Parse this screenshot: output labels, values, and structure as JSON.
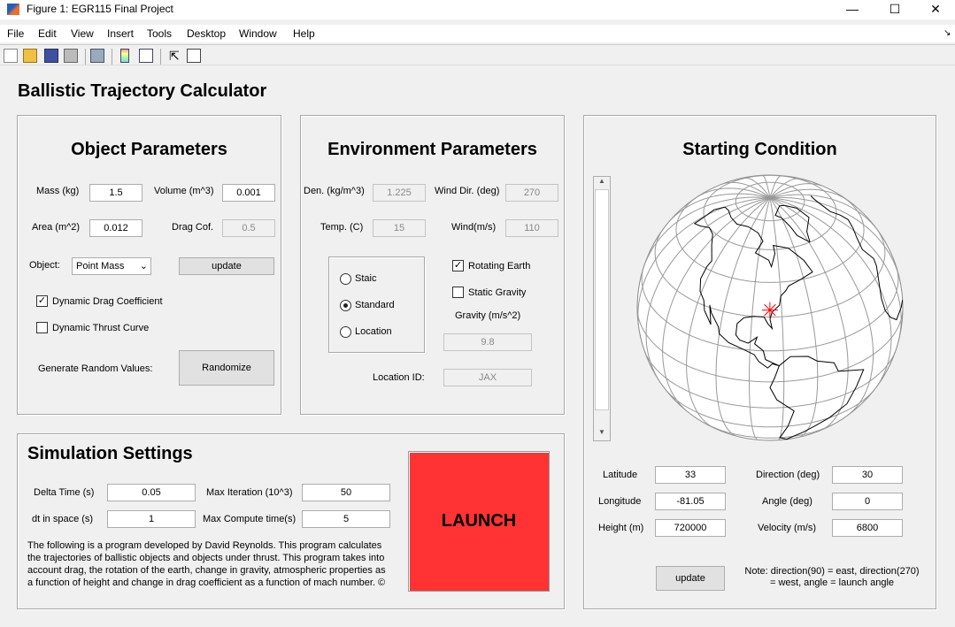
{
  "window": {
    "title": "Figure 1: EGR115 Final Project",
    "minimize": "—",
    "maximize": "☐",
    "close": "✕"
  },
  "menu": [
    "File",
    "Edit",
    "View",
    "Insert",
    "Tools",
    "Desktop",
    "Window",
    "Help"
  ],
  "toolbar": [
    "new-figure",
    "open-file",
    "save",
    "print",
    "link-plot",
    "insert-colorbar",
    "insert-legend",
    "edit-plot",
    "property-inspector"
  ],
  "app_title": "Ballistic Trajectory Calculator",
  "object": {
    "title": "Object Parameters",
    "mass_label": "Mass (kg)",
    "mass": "1.5",
    "volume_label": "Volume (m^3)",
    "volume": "0.001",
    "area_label": "Area (m^2)",
    "area": "0.012",
    "drag_label": "Drag Cof.",
    "drag": "0.5",
    "object_label": "Object:",
    "object_value": "Point Mass",
    "update": "update",
    "dynamic_drag": "Dynamic Drag Coefficient",
    "dynamic_drag_checked": true,
    "dynamic_thrust": "Dynamic Thrust Curve",
    "dynamic_thrust_checked": false,
    "random_label": "Generate Random Values:",
    "randomize": "Randomize"
  },
  "environment": {
    "title": "Environment Parameters",
    "den_label": "Den. (kg/m^3)",
    "den": "1.225",
    "winddir_label": "Wind Dir. (deg)",
    "winddir": "270",
    "temp_label": "Temp. (C)",
    "temp": "15",
    "wind_label": "Wind(m/s)",
    "wind": "110",
    "radios": [
      "Staic",
      "Standard",
      "Location"
    ],
    "radio_selected": 1,
    "rotating": "Rotating Earth",
    "rotating_checked": true,
    "static_gravity": "Static Gravity",
    "static_gravity_checked": false,
    "gravity_label": "Gravity (m/s^2)",
    "gravity": "9.8",
    "location_label": "Location ID:",
    "location": "JAX"
  },
  "start": {
    "title": "Starting Condition",
    "lat_label": "Latitude",
    "lat": "33",
    "lon_label": "Longitude",
    "lon": "-81.05",
    "height_label": "Height (m)",
    "height": "720000",
    "dir_label": "Direction (deg)",
    "dir": "30",
    "angle_label": "Angle (deg)",
    "angle": "0",
    "vel_label": "Velocity (m/s)",
    "vel": "6800",
    "update": "update",
    "note": "Note: direction(90) = east, direction(270) = west, angle = launch angle",
    "marker_color": "#ff0000"
  },
  "sim": {
    "title": "Simulation Settings",
    "dt_label": "Delta Time (s)",
    "dt": "0.05",
    "maxit_label": "Max Iteration (10^3)",
    "maxit": "50",
    "dts_label": "dt in space (s)",
    "dts": "1",
    "maxct_label": "Max Compute time(s)",
    "maxct": "5",
    "description": "The following is a program developed by David Reynolds. This program calculates the trajectories of ballistic objects and objects under thrust. This program takes into account drag, the rotation of the earth, change in gravity, atmospheric properties as a function of height and change in drag coefficient as a function of mach number. ©",
    "launch": "LAUNCH",
    "launch_color": "#ff3333"
  }
}
